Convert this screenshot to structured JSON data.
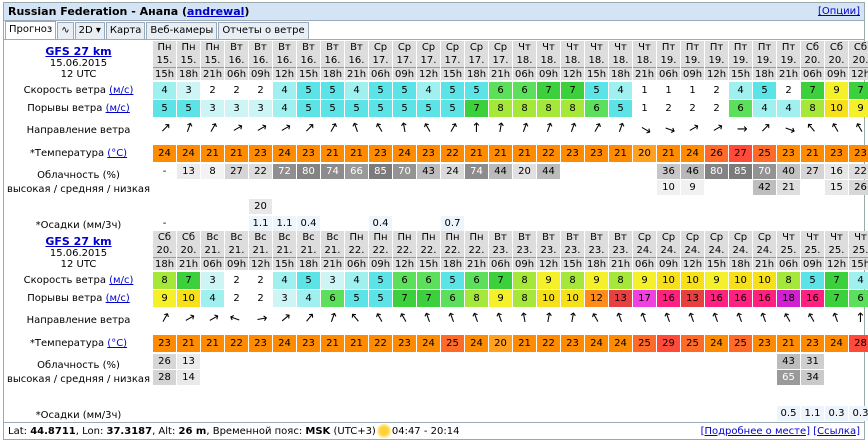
{
  "header": {
    "location": "Russian Federation - Анапа",
    "user": "andrewal",
    "options": "[Опции]"
  },
  "tabs": [
    "Прогноз",
    "∿",
    "2D ▾",
    "Карта",
    "Веб-камеры",
    "Отчеты о ветре"
  ],
  "labels": {
    "wind_speed": "Скорость ветра",
    "wind_gusts": "Порывы ветра",
    "unit_ms": "(м/с)",
    "direction": "Направление ветра",
    "temperature": "*Температура",
    "unit_c": "(°C)",
    "cloud1": "Облачность (%)",
    "cloud2": "высокая / средняя / низкая",
    "rain": "*Осадки (мм/3ч)"
  },
  "blocks": [
    {
      "model": "GFS 27 km",
      "date": "15.06.2015",
      "utc": "12 UTC",
      "days": [
        "Пн",
        "Пн",
        "Пн",
        "Вт",
        "Вт",
        "Вт",
        "Вт",
        "Вт",
        "Вт",
        "Ср",
        "Ср",
        "Ср",
        "Ср",
        "Ср",
        "Ср",
        "Чт",
        "Чт",
        "Чт",
        "Чт",
        "Чт",
        "Чт",
        "Пт",
        "Пт",
        "Пт",
        "Пт",
        "Пт",
        "Пт",
        "Сб",
        "Сб",
        "Сб"
      ],
      "dates": [
        "15.",
        "15.",
        "15.",
        "16.",
        "16.",
        "16.",
        "16.",
        "16.",
        "16.",
        "17.",
        "17.",
        "17.",
        "17.",
        "17.",
        "17.",
        "18.",
        "18.",
        "18.",
        "18.",
        "18.",
        "18.",
        "19.",
        "19.",
        "19.",
        "19.",
        "19.",
        "19.",
        "20.",
        "20.",
        "20."
      ],
      "hours": [
        "15h",
        "18h",
        "21h",
        "06h",
        "09h",
        "12h",
        "15h",
        "18h",
        "21h",
        "06h",
        "09h",
        "12h",
        "15h",
        "18h",
        "21h",
        "06h",
        "09h",
        "12h",
        "15h",
        "18h",
        "21h",
        "06h",
        "09h",
        "12h",
        "15h",
        "18h",
        "21h",
        "06h",
        "09h",
        "12h"
      ],
      "speed": [
        "4",
        "3",
        "2",
        "2",
        "2",
        "4",
        "5",
        "5",
        "4",
        "5",
        "5",
        "4",
        "5",
        "5",
        "6",
        "6",
        "7",
        "7",
        "5",
        "4",
        "1",
        "1",
        "1",
        "2",
        "4",
        "5",
        "2",
        "7",
        "9",
        "7"
      ],
      "gusts": [
        "5",
        "5",
        "3",
        "3",
        "3",
        "4",
        "5",
        "5",
        "5",
        "5",
        "5",
        "5",
        "5",
        "7",
        "8",
        "8",
        "8",
        "8",
        "6",
        "5",
        "1",
        "2",
        "2",
        "2",
        "6",
        "4",
        "4",
        "8",
        "10",
        "9"
      ],
      "dir": [
        45,
        20,
        30,
        60,
        60,
        60,
        45,
        30,
        -20,
        -30,
        -10,
        -30,
        30,
        0,
        10,
        20,
        20,
        20,
        30,
        20,
        120,
        110,
        60,
        60,
        90,
        45,
        110,
        -40,
        -30,
        -30
      ],
      "temp": [
        "24",
        "24",
        "21",
        "21",
        "23",
        "24",
        "23",
        "21",
        "21",
        "23",
        "24",
        "23",
        "22",
        "21",
        "21",
        "21",
        "22",
        "23",
        "23",
        "21",
        "20",
        "21",
        "24",
        "26",
        "27",
        "25",
        "23",
        "21",
        "23",
        "23"
      ],
      "cloud_h": [
        "-",
        "13",
        "8",
        "27",
        "22",
        "72",
        "80",
        "74",
        "66",
        "85",
        "70",
        "43",
        "24",
        "74",
        "44",
        "20",
        "44",
        "",
        "",
        "",
        "",
        "36",
        "46",
        "80",
        "85",
        "70",
        "40",
        "27",
        "16",
        "22"
      ],
      "cloud_m": [
        "",
        "",
        "",
        "",
        "",
        "",
        "",
        "",
        "",
        "",
        "",
        "",
        "",
        "",
        "",
        "",
        "",
        "",
        "",
        "",
        "",
        "10",
        "9",
        "",
        "",
        "42",
        "21",
        "",
        "15",
        "26"
      ],
      "cloud_l": [
        "",
        "",
        "",
        "",
        "",
        "",
        "",
        "",
        "",
        "",
        "",
        "",
        "",
        "",
        "",
        "",
        "",
        "",
        "",
        "",
        "",
        "",
        "",
        "",
        "",
        "",
        "",
        "",
        "",
        ""
      ],
      "rain_top": [
        "",
        "",
        "",
        "",
        "20",
        "",
        "",
        "",
        "",
        "",
        "",
        "",
        "",
        "",
        "",
        "",
        "",
        "",
        "",
        "",
        "",
        "",
        "",
        "",
        "",
        "",
        "",
        "",
        "",
        ""
      ],
      "rain": [
        "-",
        "",
        "",
        "",
        "1.1",
        "1.1",
        "0.4",
        "",
        "",
        "0.4",
        "",
        "",
        "0.7",
        "",
        "",
        "",
        "",
        "",
        "",
        "",
        "",
        "",
        "",
        "",
        "",
        "",
        "",
        "",
        "",
        ""
      ]
    },
    {
      "model": "GFS 27 km",
      "date": "15.06.2015",
      "utc": "12 UTC",
      "days": [
        "Сб",
        "Сб",
        "Вс",
        "Вс",
        "Вс",
        "Вс",
        "Вс",
        "Вс",
        "Пн",
        "Пн",
        "Пн",
        "Пн",
        "Пн",
        "Пн",
        "Вт",
        "Вт",
        "Вт",
        "Вт",
        "Вт",
        "Вт",
        "Ср",
        "Ср",
        "Ср",
        "Ср",
        "Ср",
        "Ср",
        "Чт",
        "Чт",
        "Чт",
        "Чт"
      ],
      "dates": [
        "20.",
        "20.",
        "21.",
        "21.",
        "21.",
        "21.",
        "21.",
        "21.",
        "22.",
        "22.",
        "22.",
        "22.",
        "22.",
        "22.",
        "23.",
        "23.",
        "23.",
        "23.",
        "23.",
        "23.",
        "24.",
        "24.",
        "24.",
        "24.",
        "24.",
        "24.",
        "25.",
        "25.",
        "25.",
        "25."
      ],
      "hours": [
        "18h",
        "21h",
        "06h",
        "09h",
        "12h",
        "15h",
        "18h",
        "21h",
        "06h",
        "09h",
        "12h",
        "15h",
        "18h",
        "21h",
        "06h",
        "09h",
        "12h",
        "15h",
        "18h",
        "21h",
        "06h",
        "09h",
        "12h",
        "15h",
        "18h",
        "21h",
        "06h",
        "09h",
        "12h",
        "15h"
      ],
      "speed": [
        "8",
        "7",
        "3",
        "2",
        "2",
        "4",
        "5",
        "3",
        "4",
        "5",
        "6",
        "6",
        "5",
        "6",
        "7",
        "8",
        "9",
        "8",
        "9",
        "8",
        "9",
        "10",
        "10",
        "9",
        "10",
        "10",
        "8",
        "5",
        "7",
        "4"
      ],
      "gusts": [
        "9",
        "10",
        "4",
        "2",
        "2",
        "3",
        "4",
        "6",
        "5",
        "5",
        "7",
        "7",
        "6",
        "8",
        "9",
        "8",
        "10",
        "10",
        "12",
        "13",
        "17",
        "16",
        "13",
        "16",
        "16",
        "16",
        "18",
        "16",
        "7",
        "6"
      ],
      "dir": [
        30,
        60,
        60,
        -70,
        80,
        50,
        40,
        20,
        -40,
        -30,
        -30,
        -20,
        -20,
        -20,
        -20,
        -10,
        10,
        10,
        -30,
        -20,
        -20,
        -20,
        -20,
        -20,
        -20,
        -20,
        -30,
        -30,
        -20,
        0
      ],
      "temp": [
        "23",
        "21",
        "21",
        "22",
        "23",
        "24",
        "23",
        "21",
        "21",
        "22",
        "23",
        "24",
        "25",
        "24",
        "20",
        "21",
        "22",
        "23",
        "24",
        "24",
        "25",
        "29",
        "25",
        "24",
        "25",
        "23",
        "21",
        "23",
        "24",
        "28"
      ],
      "cloud_h": [
        "26",
        "13",
        "",
        "",
        "",
        "",
        "",
        "",
        "",
        "",
        "",
        "",
        "",
        "",
        "",
        "",
        "",
        "",
        "",
        "",
        "",
        "",
        "",
        "",
        "",
        "",
        "43",
        "31",
        "",
        ""
      ],
      "cloud_m": [
        "28",
        "14",
        "",
        "",
        "",
        "",
        "",
        "",
        "",
        "",
        "",
        "",
        "",
        "",
        "",
        "",
        "",
        "",
        "",
        "",
        "",
        "",
        "",
        "",
        "",
        "",
        "65",
        "34",
        "",
        ""
      ],
      "cloud_l": [
        "",
        "",
        "",
        "",
        "",
        "",
        "",
        "",
        "",
        "",
        "",
        "",
        "",
        "",
        "",
        "",
        "",
        "",
        "",
        "",
        "",
        "",
        "",
        "",
        "",
        "",
        "",
        "",
        "",
        ""
      ],
      "rain": [
        "",
        "",
        "",
        "",
        "",
        "",
        "",
        "",
        "",
        "",
        "",
        "",
        "",
        "",
        "",
        "",
        "",
        "",
        "",
        "",
        "",
        "",
        "",
        "",
        "",
        "",
        "0.5",
        "1.1",
        "0.3",
        "0.3"
      ]
    }
  ],
  "footer": {
    "lat_label": "Lat:",
    "lat": "44.8711",
    "lon_label": "Lon:",
    "lon": "37.3187",
    "alt_label": "Alt:",
    "alt": "26 m",
    "tz_label": "Временной пояс:",
    "tz": "MSK",
    "tz_offset": "(UTC+3)",
    "sun": "04:47 - 20:14",
    "link1": "[Подробнее о месте]",
    "link2": "[Ссылка]"
  },
  "colors": {
    "header_bg": "#d4e4f4"
  }
}
